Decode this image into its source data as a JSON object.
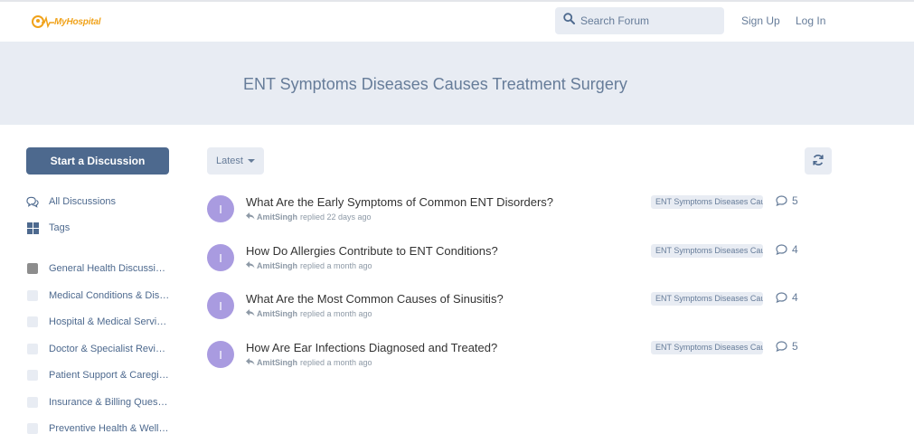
{
  "header": {
    "logo_text": "MyHospital",
    "search_placeholder": "Search Forum",
    "signup_label": "Sign Up",
    "login_label": "Log In"
  },
  "hero": {
    "title": "ENT Symptoms Diseases Causes Treatment Surgery"
  },
  "sidebar": {
    "start_label": "Start a Discussion",
    "nav": [
      {
        "label": "All Discussions",
        "icon": "comments-icon"
      },
      {
        "label": "Tags",
        "icon": "grid-icon"
      }
    ],
    "tags": [
      {
        "label": "General Health Discussions",
        "color": "#8d8d8d"
      },
      {
        "label": "Medical Conditions & Diseases",
        "color": "#e8ecf3"
      },
      {
        "label": "Hospital & Medical Services",
        "color": "#e8ecf3"
      },
      {
        "label": "Doctor & Specialist Reviews",
        "color": "#e8ecf3"
      },
      {
        "label": "Patient Support & Caregivers",
        "color": "#e8ecf3"
      },
      {
        "label": "Insurance & Billing Questions",
        "color": "#e8ecf3"
      },
      {
        "label": "Preventive Health & Wellness",
        "color": "#e8ecf3"
      }
    ]
  },
  "toolbar": {
    "sort_label": "Latest"
  },
  "discussions": [
    {
      "avatar": "I",
      "title": "What Are the Early Symptoms of Common ENT Disorders?",
      "user": "AmitSingh",
      "action": "replied 22 days ago",
      "tag": "ENT Symptoms Diseases Causes",
      "replies": "5"
    },
    {
      "avatar": "I",
      "title": "How Do Allergies Contribute to ENT Conditions?",
      "user": "AmitSingh",
      "action": "replied a month ago",
      "tag": "ENT Symptoms Diseases Causes",
      "replies": "4"
    },
    {
      "avatar": "I",
      "title": "What Are the Most Common Causes of Sinusitis?",
      "user": "AmitSingh",
      "action": "replied a month ago",
      "tag": "ENT Symptoms Diseases Causes",
      "replies": "4"
    },
    {
      "avatar": "I",
      "title": "How Are Ear Infections Diagnosed and Treated?",
      "user": "AmitSingh",
      "action": "replied a month ago",
      "tag": "ENT Symptoms Diseases Causes",
      "replies": "5"
    }
  ],
  "colors": {
    "accent": "#4d698e",
    "muted": "#667c99",
    "panel": "#e8ecf3",
    "avatar": "#a99be0",
    "logo": "#f0a21a"
  }
}
